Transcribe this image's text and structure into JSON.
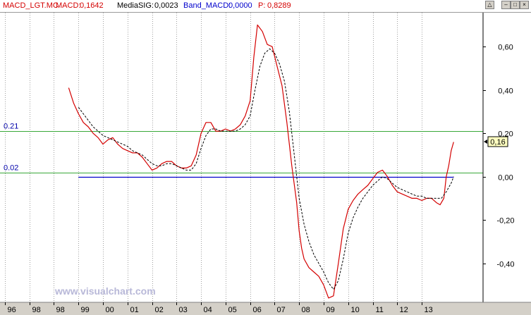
{
  "header": {
    "symbol": "MACD_LGT.MC",
    "macd_label": "MACD:",
    "macd_value": "0,1642",
    "signal_label": "MediaSIG:",
    "signal_value": "0,0023",
    "band_label": "Band_MACD:",
    "band_value": "0,0000",
    "p_label": "P:",
    "p_value": "0,8289"
  },
  "colors": {
    "macd": "#d40000",
    "signal": "#000000",
    "band_upper": "#3aa83a",
    "band_lower": "#3aa83a",
    "zero": "#0000cc",
    "axis_text": "#000000",
    "level_text": "#0000aa",
    "watermark": "#b8b8d8",
    "marker_fill": "#ffffc0"
  },
  "watermark": "www.visualchart.com",
  "chart_data": {
    "type": "line",
    "xlim": [
      1995.8,
      2015.5
    ],
    "ylim": [
      -0.58,
      0.76
    ],
    "x_ticks": [
      {
        "value": 1996,
        "label": "96"
      },
      {
        "value": 1997,
        "label": "98"
      },
      {
        "value": 1998,
        "label": "98"
      },
      {
        "value": 1999,
        "label": "99"
      },
      {
        "value": 2000,
        "label": "00"
      },
      {
        "value": 2001,
        "label": "01"
      },
      {
        "value": 2002,
        "label": "02"
      },
      {
        "value": 2003,
        "label": "03"
      },
      {
        "value": 2004,
        "label": "04"
      },
      {
        "value": 2005,
        "label": "05"
      },
      {
        "value": 2006,
        "label": "06"
      },
      {
        "value": 2007,
        "label": "07"
      },
      {
        "value": 2008,
        "label": "08"
      },
      {
        "value": 2009,
        "label": "09"
      },
      {
        "value": 2010,
        "label": "10"
      },
      {
        "value": 2011,
        "label": "11"
      },
      {
        "value": 2012,
        "label": "12"
      },
      {
        "value": 2013,
        "label": "13"
      }
    ],
    "y_ticks": [
      {
        "value": 0.6,
        "label": "0,60"
      },
      {
        "value": 0.4,
        "label": "0,40"
      },
      {
        "value": 0.2,
        "label": "0,20"
      },
      {
        "value": 0.0,
        "label": "0,00"
      },
      {
        "value": -0.2,
        "label": "-0,20"
      },
      {
        "value": -0.4,
        "label": "-0,40"
      }
    ],
    "levels": [
      {
        "value": 0.21,
        "label": "0.21"
      },
      {
        "value": 0.02,
        "label": "0.02"
      }
    ],
    "zero_line": {
      "x_start": 1999.0,
      "x_end": 2014.3
    },
    "last_value": {
      "value": 0.16,
      "label": "0,16"
    },
    "series": [
      {
        "key": "macd",
        "x": [
          1998.6,
          1998.8,
          1999.0,
          1999.2,
          1999.4,
          1999.6,
          1999.8,
          2000.0,
          2000.2,
          2000.4,
          2000.6,
          2000.8,
          2001.0,
          2001.2,
          2001.4,
          2001.6,
          2001.8,
          2002.0,
          2002.2,
          2002.4,
          2002.6,
          2002.8,
          2003.0,
          2003.2,
          2003.4,
          2003.6,
          2003.8,
          2004.0,
          2004.2,
          2004.4,
          2004.6,
          2004.8,
          2005.0,
          2005.2,
          2005.4,
          2005.6,
          2005.8,
          2006.0,
          2006.15,
          2006.3,
          2006.5,
          2006.7,
          2006.9,
          2007.1,
          2007.3,
          2007.5,
          2007.7,
          2007.9,
          2008.0,
          2008.1,
          2008.2,
          2008.4,
          2008.6,
          2008.8,
          2009.0,
          2009.2,
          2009.4,
          2009.6,
          2009.8,
          2010.0,
          2010.2,
          2010.4,
          2010.6,
          2010.8,
          2011.0,
          2011.2,
          2011.4,
          2011.6,
          2011.8,
          2012.0,
          2012.2,
          2012.4,
          2012.6,
          2012.8,
          2013.0,
          2013.2,
          2013.4,
          2013.6,
          2013.75,
          2013.9,
          2014.0,
          2014.1,
          2014.2,
          2014.3
        ],
        "y": [
          0.41,
          0.34,
          0.29,
          0.25,
          0.23,
          0.2,
          0.18,
          0.15,
          0.17,
          0.18,
          0.15,
          0.13,
          0.12,
          0.11,
          0.11,
          0.09,
          0.06,
          0.03,
          0.04,
          0.06,
          0.07,
          0.07,
          0.05,
          0.04,
          0.04,
          0.05,
          0.1,
          0.2,
          0.25,
          0.25,
          0.21,
          0.21,
          0.22,
          0.21,
          0.22,
          0.24,
          0.28,
          0.35,
          0.55,
          0.7,
          0.67,
          0.61,
          0.6,
          0.51,
          0.42,
          0.25,
          0.05,
          -0.12,
          -0.25,
          -0.33,
          -0.38,
          -0.42,
          -0.44,
          -0.46,
          -0.5,
          -0.56,
          -0.55,
          -0.4,
          -0.24,
          -0.15,
          -0.11,
          -0.08,
          -0.06,
          -0.04,
          -0.01,
          0.02,
          0.03,
          0.0,
          -0.04,
          -0.07,
          -0.08,
          -0.09,
          -0.1,
          -0.1,
          -0.11,
          -0.1,
          -0.1,
          -0.12,
          -0.13,
          -0.1,
          0.0,
          0.05,
          0.12,
          0.16
        ]
      },
      {
        "key": "signal",
        "x": [
          1999.0,
          1999.2,
          1999.4,
          1999.6,
          1999.8,
          2000.0,
          2000.2,
          2000.4,
          2000.6,
          2000.8,
          2001.0,
          2001.2,
          2001.4,
          2001.6,
          2001.8,
          2002.0,
          2002.2,
          2002.4,
          2002.6,
          2002.8,
          2003.0,
          2003.2,
          2003.4,
          2003.6,
          2003.8,
          2004.0,
          2004.2,
          2004.4,
          2004.6,
          2004.8,
          2005.0,
          2005.2,
          2005.4,
          2005.6,
          2005.8,
          2006.0,
          2006.2,
          2006.4,
          2006.6,
          2006.8,
          2007.0,
          2007.2,
          2007.4,
          2007.6,
          2007.8,
          2008.0,
          2008.2,
          2008.4,
          2008.6,
          2008.8,
          2009.0,
          2009.2,
          2009.4,
          2009.6,
          2009.8,
          2010.0,
          2010.2,
          2010.4,
          2010.6,
          2010.8,
          2011.0,
          2011.2,
          2011.4,
          2011.6,
          2011.8,
          2012.0,
          2012.2,
          2012.4,
          2012.6,
          2012.8,
          2013.0,
          2013.2,
          2013.4,
          2013.6,
          2013.8,
          2014.0,
          2014.2,
          2014.3
        ],
        "y": [
          0.32,
          0.29,
          0.26,
          0.23,
          0.21,
          0.19,
          0.18,
          0.17,
          0.16,
          0.15,
          0.14,
          0.12,
          0.11,
          0.1,
          0.08,
          0.06,
          0.05,
          0.05,
          0.06,
          0.06,
          0.05,
          0.04,
          0.03,
          0.03,
          0.06,
          0.13,
          0.19,
          0.22,
          0.22,
          0.21,
          0.21,
          0.21,
          0.21,
          0.22,
          0.24,
          0.28,
          0.4,
          0.51,
          0.57,
          0.59,
          0.57,
          0.52,
          0.44,
          0.3,
          0.1,
          -0.1,
          -0.22,
          -0.3,
          -0.36,
          -0.4,
          -0.44,
          -0.49,
          -0.52,
          -0.48,
          -0.38,
          -0.26,
          -0.19,
          -0.14,
          -0.1,
          -0.07,
          -0.04,
          -0.02,
          0.0,
          -0.01,
          -0.03,
          -0.05,
          -0.06,
          -0.07,
          -0.08,
          -0.09,
          -0.09,
          -0.1,
          -0.1,
          -0.1,
          -0.1,
          -0.07,
          -0.03,
          0.0
        ]
      }
    ]
  }
}
